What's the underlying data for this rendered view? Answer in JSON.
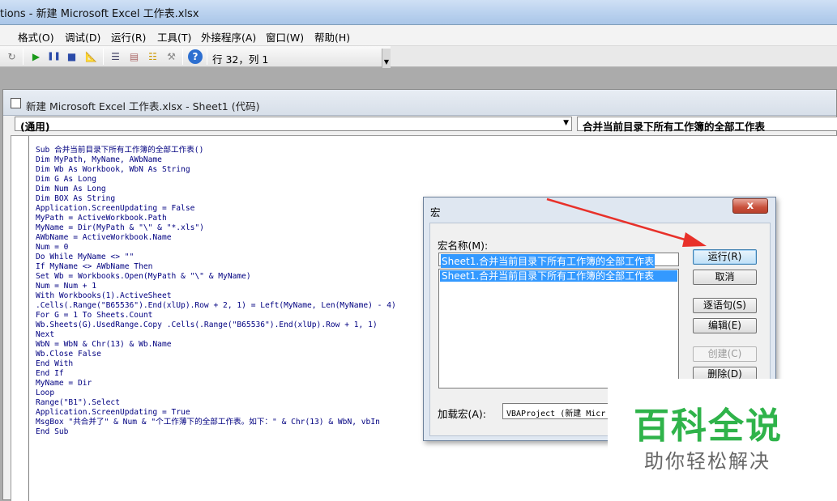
{
  "window": {
    "title": "tions - 新建 Microsoft Excel 工作表.xlsx"
  },
  "menu": {
    "items": [
      "格式(O)",
      "调试(D)",
      "运行(R)",
      "工具(T)",
      "外接程序(A)",
      "窗口(W)",
      "帮助(H)"
    ]
  },
  "toolbar": {
    "position": "行 32，列 1"
  },
  "code_window": {
    "title": "新建 Microsoft Excel 工作表.xlsx - Sheet1 (代码)",
    "object_combo": "(通用)",
    "procedure_combo": "合并当前目录下所有工作簿的全部工作表",
    "lines": [
      "Sub 合并当前目录下所有工作簿的全部工作表()",
      "Dim MyPath, MyName, AWbName",
      "Dim Wb As Workbook, WbN As String",
      "Dim G As Long",
      "Dim Num As Long",
      "Dim BOX As String",
      "Application.ScreenUpdating = False",
      "MyPath = ActiveWorkbook.Path",
      "MyName = Dir(MyPath & \"\\\" & \"*.xls\")",
      "AWbName = ActiveWorkbook.Name",
      "Num = 0",
      "Do While MyName <> \"\"",
      "If MyName <> AWbName Then",
      "Set Wb = Workbooks.Open(MyPath & \"\\\" & MyName)",
      "Num = Num + 1",
      "With Workbooks(1).ActiveSheet",
      ".Cells(.Range(\"B65536\").End(xlUp).Row + 2, 1) = Left(MyName, Len(MyName) - 4)",
      "For G = 1 To Sheets.Count",
      "Wb.Sheets(G).UsedRange.Copy .Cells(.Range(\"B65536\").End(xlUp).Row + 1, 1)",
      "Next",
      "WbN = WbN & Chr(13) & Wb.Name",
      "Wb.Close False",
      "End With",
      "End If",
      "MyName = Dir",
      "Loop",
      "Range(\"B1\").Select",
      "Application.ScreenUpdating = True",
      "MsgBox \"共合并了\" & Num & \"个工作薄下的全部工作表。如下：\" & Chr(13) & WbN, vbIn",
      "End Sub"
    ]
  },
  "dialog": {
    "title": "宏",
    "close": "x",
    "macro_name_label": "宏名称(M):",
    "macro_name_value": "Sheet1.合并当前目录下所有工作簿的全部工作表",
    "macro_list": [
      "Sheet1.合并当前目录下所有工作簿的全部工作表"
    ],
    "buttons": {
      "run": "运行(R)",
      "cancel": "取消",
      "step": "逐语句(S)",
      "edit": "编辑(E)",
      "create": "创建(C)",
      "delete": "删除(D)"
    },
    "macros_in_label": "加载宏(A):",
    "macros_in_value": "VBAProject (新建 Micr"
  },
  "watermark": {
    "title": "百科全说",
    "subtitle": "助你轻松解决"
  },
  "colors": {
    "code_text": "#000080",
    "selection": "#3399ff",
    "annotation_arrow": "#e8312a",
    "watermark_green": "#2fb34a"
  }
}
